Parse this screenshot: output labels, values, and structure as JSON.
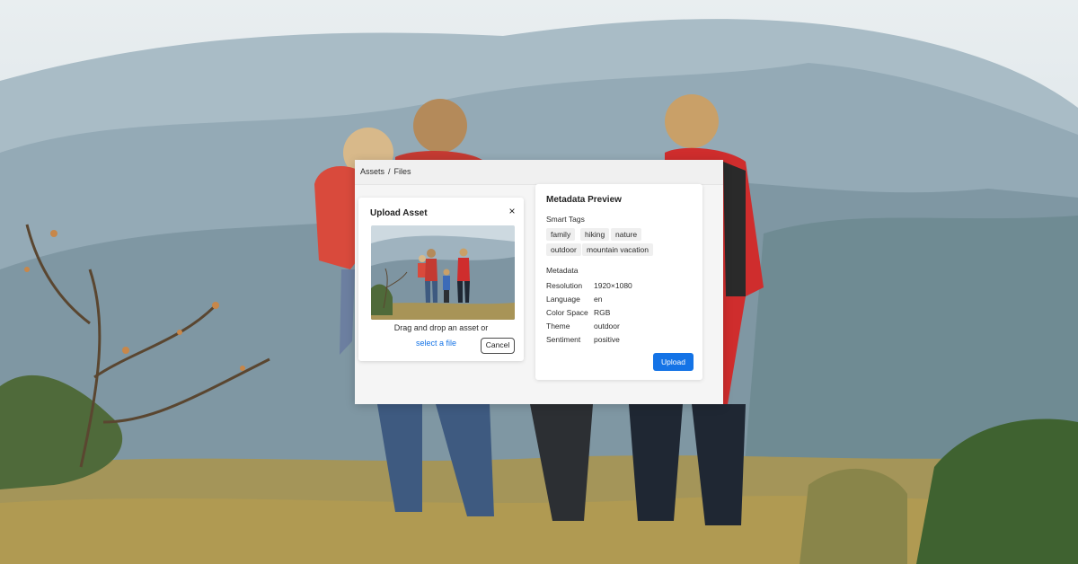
{
  "breadcrumb": {
    "root": "Assets",
    "separator": "/",
    "current": "Files"
  },
  "upload_dialog": {
    "title": "Upload Asset",
    "close_symbol": "×",
    "drop_text": "Drag and drop an asset or",
    "select_link": "select a file",
    "cancel_label": "Cancel"
  },
  "metadata": {
    "title": "Metadata Preview",
    "smart_tags_label": "Smart Tags",
    "tags": [
      "family",
      "hiking",
      "nature",
      "outdoor",
      "mountain vacation"
    ],
    "section_label": "Metadata",
    "rows": [
      {
        "key": "Resolution",
        "value": "1920×1080"
      },
      {
        "key": "Language",
        "value": "en"
      },
      {
        "key": "Color Space",
        "value": "RGB"
      },
      {
        "key": "Theme",
        "value": "outdoor"
      },
      {
        "key": "Sentiment",
        "value": "positive"
      }
    ],
    "upload_label": "Upload"
  },
  "colors": {
    "accent": "#1473e6",
    "panel": "#ffffff",
    "window": "#f5f5f5"
  },
  "icons": {
    "close": "close-icon"
  }
}
